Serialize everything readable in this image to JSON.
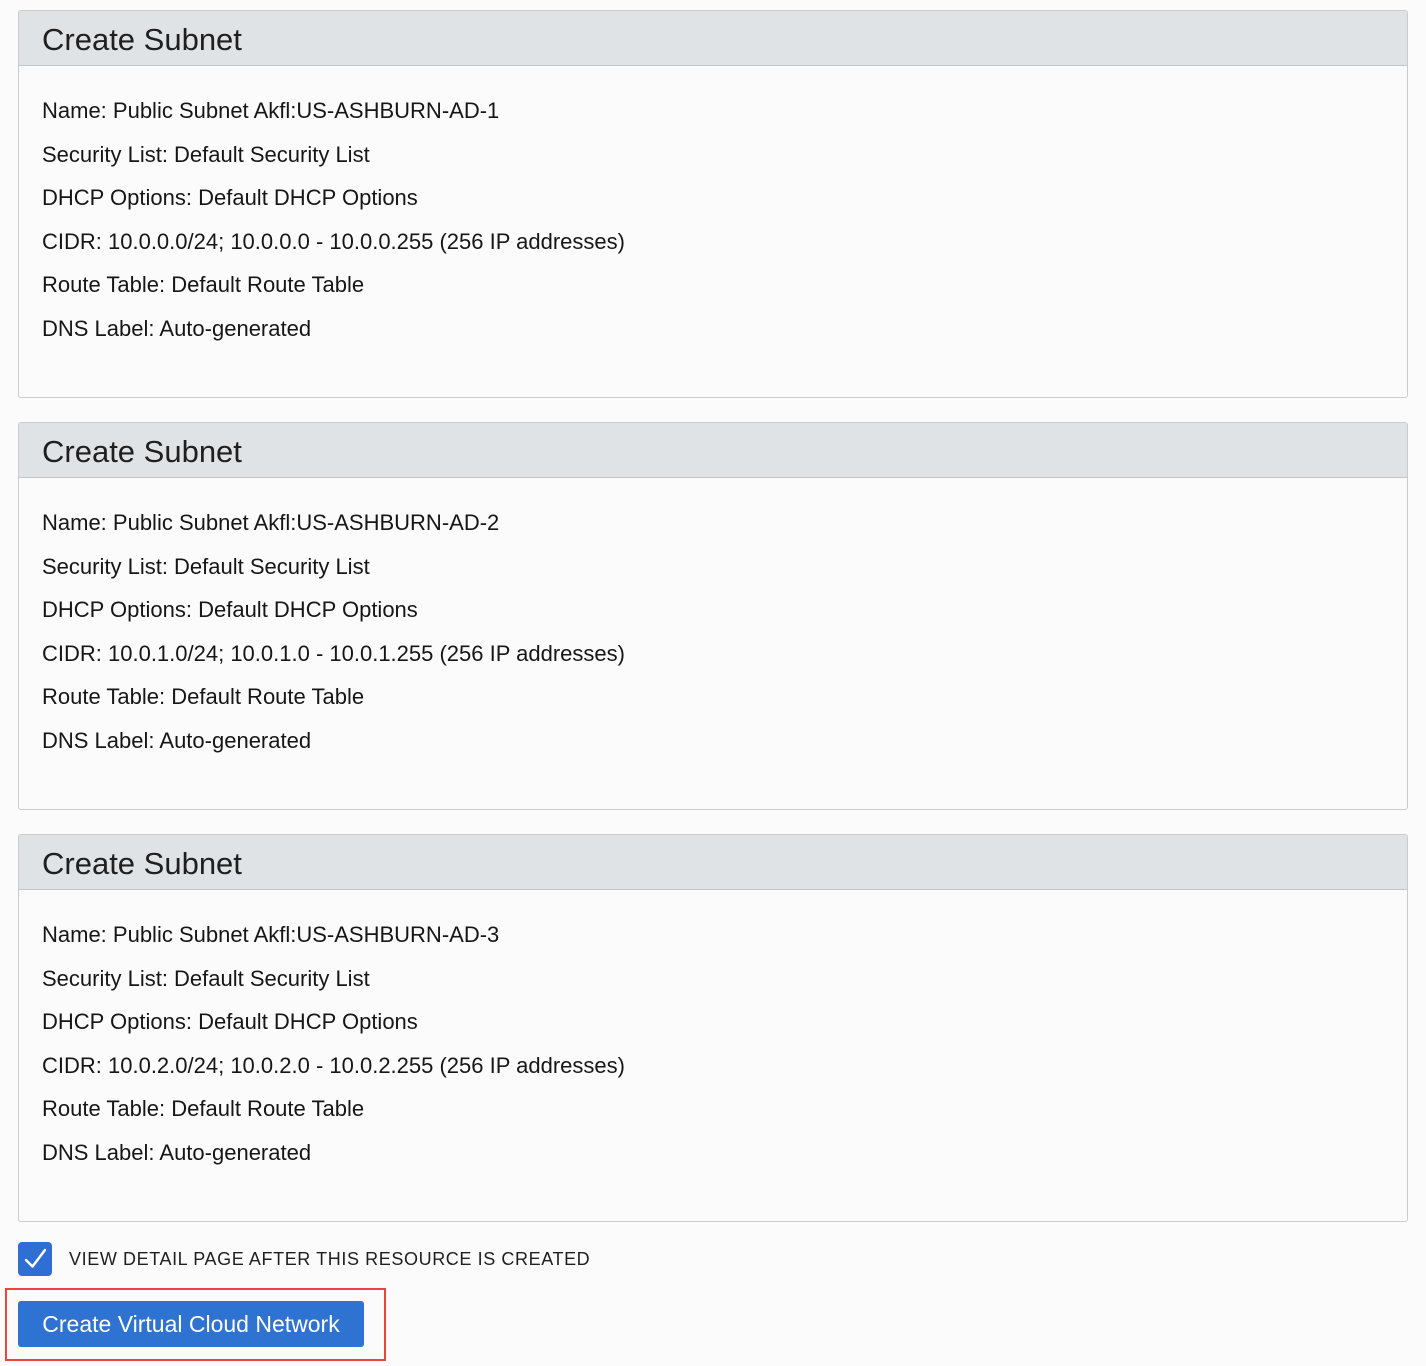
{
  "subnets": [
    {
      "title": "Create Subnet",
      "lines": [
        "Name: Public Subnet Akfl:US-ASHBURN-AD-1",
        "Security List: Default Security List",
        "DHCP Options: Default DHCP Options",
        "CIDR: 10.0.0.0/24; 10.0.0.0 - 10.0.0.255 (256 IP addresses)",
        "Route Table: Default Route Table",
        "DNS Label: Auto-generated"
      ]
    },
    {
      "title": "Create Subnet",
      "lines": [
        "Name: Public Subnet Akfl:US-ASHBURN-AD-2",
        "Security List: Default Security List",
        "DHCP Options: Default DHCP Options",
        "CIDR: 10.0.1.0/24; 10.0.1.0 - 10.0.1.255 (256 IP addresses)",
        "Route Table: Default Route Table",
        "DNS Label: Auto-generated"
      ]
    },
    {
      "title": "Create Subnet",
      "lines": [
        "Name: Public Subnet Akfl:US-ASHBURN-AD-3",
        "Security List: Default Security List",
        "DHCP Options: Default DHCP Options",
        "CIDR: 10.0.2.0/24; 10.0.2.0 - 10.0.2.255 (256 IP addresses)",
        "Route Table: Default Route Table",
        "DNS Label: Auto-generated"
      ]
    }
  ],
  "view_detail_checkbox": {
    "checked": true,
    "label": "VIEW DETAIL PAGE AFTER THIS RESOURCE IS CREATED",
    "icon": "checkmark-icon"
  },
  "create_button": {
    "label": "Create Virtual Cloud Network"
  },
  "colors": {
    "page_background": "#fbfbfb",
    "panel_header": "#e0e3e6",
    "panel_border": "#c9cbce",
    "primary_blue": "#2e72d2",
    "highlight_red": "#e8453c"
  }
}
